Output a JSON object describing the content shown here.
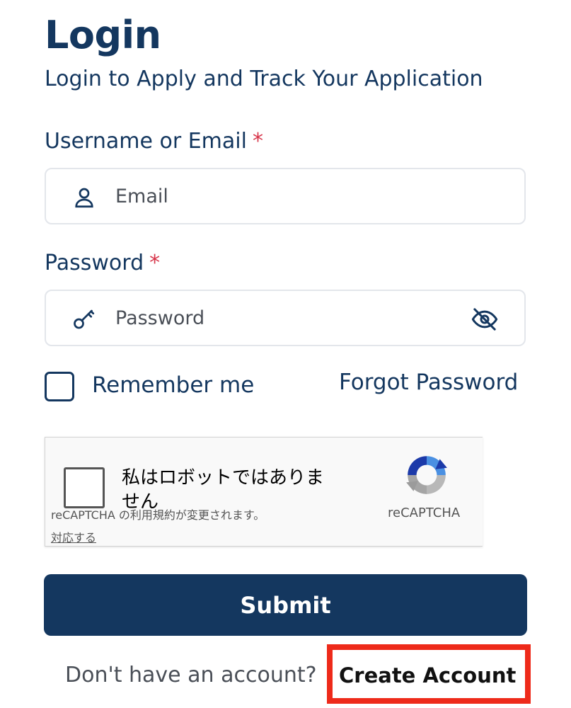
{
  "header": {
    "title": "Login",
    "subtitle": "Login to Apply and Track Your Application"
  },
  "form": {
    "username_label": "Username or Email",
    "username_required_mark": "*",
    "username_placeholder": "Email",
    "username_value": "",
    "username_icon": "user-icon",
    "password_label": "Password",
    "password_required_mark": "*",
    "password_placeholder": "Password",
    "password_value": "",
    "password_icon": "key-icon",
    "visibility_icon": "eye-off-icon",
    "remember_label": "Remember me",
    "remember_checked": false,
    "forgot_label": "Forgot Password"
  },
  "recaptcha": {
    "checkbox_text": "私はロボットではありません",
    "notice": "reCAPTCHA の利用規約が変更されます。",
    "action_link": "対応する",
    "brand": "reCAPTCHA"
  },
  "actions": {
    "submit_label": "Submit",
    "no_account_text": "Don't have an account?",
    "create_account_label": "Create Account"
  },
  "colors": {
    "primary": "#14375f",
    "required": "#d7354a",
    "highlight_box": "#ee2a1a",
    "field_border": "#e3e6eb"
  }
}
